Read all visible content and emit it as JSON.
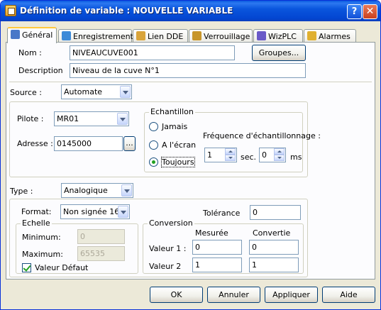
{
  "window": {
    "title": "Définition de variable : NOUVELLE VARIABLE",
    "help_label": "?",
    "close_label": "✕"
  },
  "tabs": [
    {
      "label": "Général",
      "icon": "general-tab-icon",
      "color": "#4a78c8"
    },
    {
      "label": "Enregistrement",
      "icon": "recording-tab-icon",
      "color": "#3d8ad8"
    },
    {
      "label": "Lien DDE",
      "icon": "dde-link-tab-icon",
      "color": "#d9a43a"
    },
    {
      "label": "Verrouillage",
      "icon": "lock-tab-icon",
      "color": "#c8962a"
    },
    {
      "label": "WizPLC",
      "icon": "wizplc-tab-icon",
      "color": "#6a5ac8"
    },
    {
      "label": "Alarmes",
      "icon": "alarm-tab-icon",
      "color": "#e0b030"
    }
  ],
  "general": {
    "nom_label": "Nom :",
    "nom_value": "NIVEAUCUVE001",
    "groupes_button": "Groupes...",
    "description_label": "Description",
    "description_value": "Niveau de la cuve N°1",
    "source_label": "Source :",
    "source_value": "Automate",
    "pilote_label": "Pilote :",
    "pilote_value": "MR01",
    "adresse_label": "Adresse :",
    "adresse_value": "0145000",
    "browse_label": "...",
    "echantillon": {
      "title": "Echantillon",
      "jamais": "Jamais",
      "a_lecran": "A l'écran",
      "toujours": "Toujours",
      "selected": "Toujours",
      "frequence_label": "Fréquence d'échantillonnage :",
      "sec_value": "1",
      "sec_label": "sec.",
      "ms_value": "0",
      "ms_label": "ms"
    },
    "type_label": "Type :",
    "type_value": "Analogique",
    "format_label": "Format:",
    "format_value": "Non signée 16",
    "tolerance_label": "Tolérance",
    "tolerance_value": "0",
    "echelle": {
      "title": "Echelle",
      "minimum_label": "Minimum:",
      "minimum_value": "0",
      "maximum_label": "Maximum:",
      "maximum_value": "65535",
      "valeur_defaut_label": "Valeur Défaut",
      "valeur_defaut_checked": true
    },
    "conversion": {
      "title": "Conversion",
      "mesuree_label": "Mesurée",
      "convertie_label": "Convertie",
      "valeur1_label": "Valeur 1 :",
      "valeur1_mesuree": "0",
      "valeur1_convertie": "0",
      "valeur2_label": "Valeur 2",
      "valeur2_mesuree": "1",
      "valeur2_convertie": "1"
    }
  },
  "buttons": {
    "ok": "OK",
    "annuler": "Annuler",
    "appliquer": "Appliquer",
    "aide": "Aide"
  }
}
